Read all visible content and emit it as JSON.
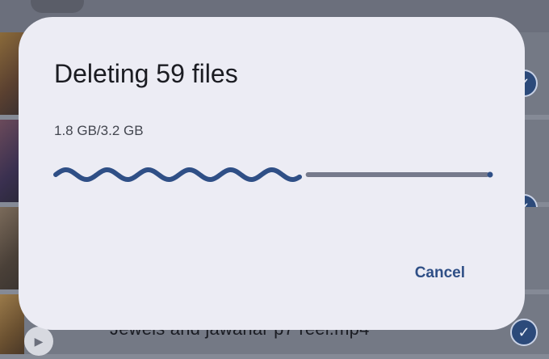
{
  "dialog": {
    "title": "Deleting 59 files",
    "progress_text": "1.8 GB/3.2 GB",
    "progress_fraction": 0.5625,
    "cancel_label": "Cancel"
  },
  "background_list": {
    "visible_filename": "Jewels and jawahar p7 reel.mp4"
  },
  "colors": {
    "accent": "#2f4f86",
    "track": "#767a8c",
    "dialog_surface": "#ececf4",
    "scrim": "#6b6f7c"
  },
  "icons": {
    "selected": "checkmark-circle-icon",
    "video": "play-icon"
  }
}
